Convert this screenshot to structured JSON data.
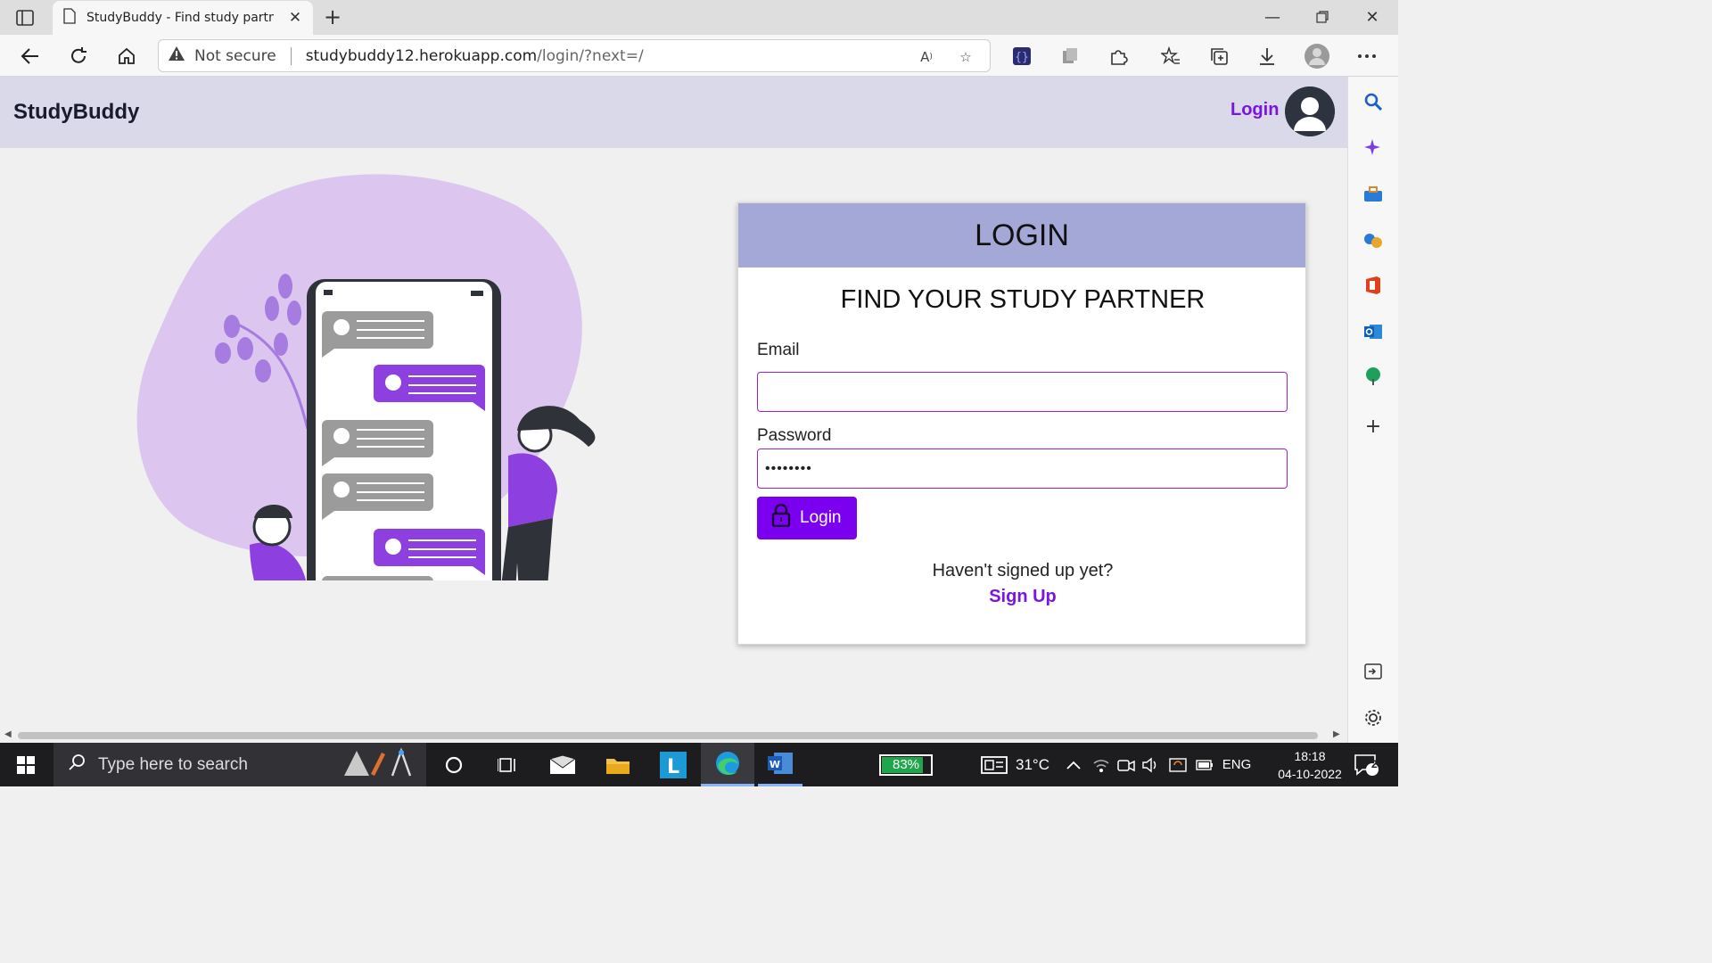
{
  "browser": {
    "tab_title": "StudyBuddy - Find study partner",
    "security_label": "Not secure",
    "url_host": "studybuddy12.herokuapp.com",
    "url_path": "/login/?next=/"
  },
  "site": {
    "brand": "StudyBuddy",
    "nav_login": "Login"
  },
  "login_card": {
    "header": "LOGIN",
    "subtitle": "FIND YOUR STUDY PARTNER",
    "email_label": "Email",
    "email_value": "",
    "password_label": "Password",
    "password_value": "••••••••",
    "submit_label": "Login",
    "signup_prompt": "Haven't signed up yet?",
    "signup_link": "Sign Up"
  },
  "taskbar": {
    "search_placeholder": "Type here to search",
    "battery": "83%",
    "temperature": "31°C",
    "language": "ENG",
    "time": "18:18",
    "date": "04-10-2022",
    "notification_count": "2"
  },
  "colors": {
    "accent": "#7b00f0",
    "card_header": "#a3a8d6",
    "navbar": "#d9d9ea"
  }
}
